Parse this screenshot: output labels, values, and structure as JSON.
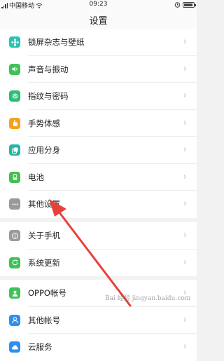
{
  "status_bar": {
    "carrier": "中国移动",
    "time": "09:23",
    "battery_level": 0.9
  },
  "header": {
    "title": "设置"
  },
  "group1": [
    {
      "label": "锁屏杂志与壁纸",
      "icon": "wallpaper-icon",
      "color": "#2bc2b4"
    },
    {
      "label": "声音与振动",
      "icon": "speaker-icon",
      "color": "#3fc158"
    },
    {
      "label": "指纹与密码",
      "icon": "fingerprint-icon",
      "color": "#2bbf72"
    },
    {
      "label": "手势体感",
      "icon": "hand-gesture-icon",
      "color": "#f5a21b"
    },
    {
      "label": "应用分身",
      "icon": "app-clone-icon",
      "color": "#27b6a4"
    },
    {
      "label": "电池",
      "icon": "battery-icon",
      "color": "#43c04f"
    },
    {
      "label": "其他设置",
      "icon": "more-dots-icon",
      "color": "#9a9a9a"
    }
  ],
  "group2": [
    {
      "label": "关于手机",
      "icon": "info-icon",
      "color": "#9a9a9a"
    },
    {
      "label": "系统更新",
      "icon": "update-icon",
      "color": "#3fc158"
    }
  ],
  "group3": [
    {
      "label": "OPPO帐号",
      "icon": "user-icon",
      "color": "#3fc158"
    },
    {
      "label": "其他帐号",
      "icon": "account-icon",
      "color": "#2f8ff0"
    },
    {
      "label": "云服务",
      "icon": "cloud-icon",
      "color": "#2f8ff0"
    }
  ],
  "chevron": "›",
  "watermark": "Bai 经验 jingyan.baidu.com"
}
